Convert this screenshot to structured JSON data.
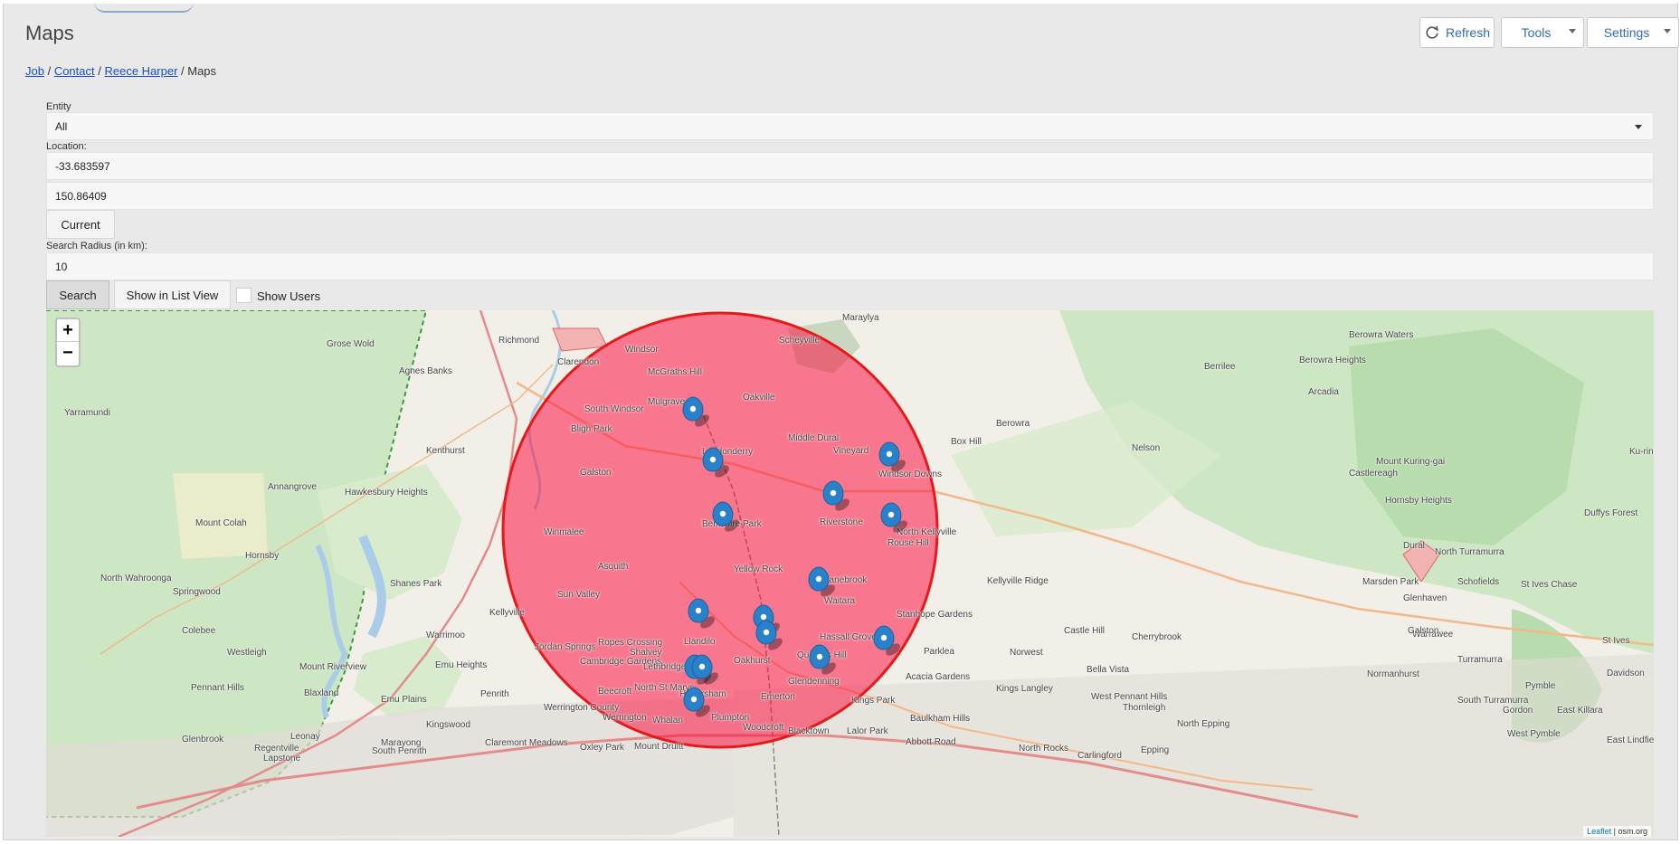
{
  "header": {
    "title": "Maps",
    "refresh_label": "Refresh",
    "tools_label": "Tools",
    "settings_label": "Settings"
  },
  "breadcrumb": {
    "items": [
      "Job",
      "Contact",
      "Reece Harper"
    ],
    "current": "Maps",
    "separator": " / "
  },
  "form": {
    "entity_label": "Entity",
    "entity_value": "All",
    "location_label": "Location:",
    "latitude": "-33.683597",
    "longitude": "150.86409",
    "current_button": "Current",
    "radius_label": "Search Radius (in km):",
    "radius_value": "10",
    "search_button": "Search",
    "list_view_button": "Show in List View",
    "show_users_label": "Show Users"
  },
  "map": {
    "zoom_in": "+",
    "zoom_out": "−",
    "attribution_leaflet": "Leaflet",
    "attribution_osm": "osm.org",
    "radius_color": "#f03",
    "places": [
      "Maraylya",
      "Grose Wold",
      "Richmond",
      "Clarendon",
      "Windsor",
      "Scheyville",
      "Berowra Waters",
      "Agnes Banks",
      "McGraths Hill",
      "Oakville",
      "Berrilee",
      "Berowra Heights",
      "Yarramundi",
      "South Windsor",
      "Mulgrave",
      "Arcadia",
      "Berowra",
      "Bligh Park",
      "Middle Dural",
      "Box Hill",
      "Kenthurst",
      "Londonderry",
      "Vineyard",
      "Nelson",
      "Galston",
      "Windsor Downs",
      "Annangrove",
      "Hawkesbury Heights",
      "Castlereagh",
      "Hornsby Heights",
      "Mount Colah",
      "Winmalee",
      "Berkshire Park",
      "Riverstone",
      "Rouse Hill",
      "North Kellyville",
      "Dural",
      "Asquith",
      "Yellow Rock",
      "Marsden Park",
      "Schofields",
      "Hornsby",
      "North Wahroonga",
      "Springwood",
      "Sun Valley",
      "Shanes Park",
      "Cranebrook",
      "Kellyville Ridge",
      "Glenhaven",
      "Waitara",
      "Stanhope Gardens",
      "Kellyville",
      "Llandilo",
      "Colebee",
      "Warrimoo",
      "Jordan Springs",
      "Ropes Crossing",
      "Shalvey",
      "Hassall Grove",
      "Parklea",
      "Norwest",
      "Castle Hill",
      "Cherrybrook",
      "Westleigh",
      "Mount Riverview",
      "Emu Heights",
      "Cambridge Gardens",
      "Lethbridge Park",
      "Oakhurst",
      "Quakers Hill",
      "Acacia Gardens",
      "Bella Vista",
      "Pennant Hills",
      "Blaxland",
      "Emu Plains",
      "Penrith",
      "Werrington County",
      "North St Marys",
      "Hebersham",
      "Glendenning",
      "Kings Park",
      "Kings Langley",
      "West Pennant Hills",
      "Beecroft",
      "Emerton",
      "Marayong",
      "Werrington",
      "Whalan",
      "Plumpton",
      "Woodcroft",
      "Blacktown",
      "Lalor Park",
      "Baulkham Hills",
      "North Epping",
      "Kingswood",
      "Claremont Meadows",
      "Oxley Park",
      "Mount Druitt",
      "Glenbrook",
      "Regentville",
      "South Penrith",
      "Leonay",
      "Lapstone",
      "North Rocks",
      "Carlingford",
      "Epping",
      "Davidson",
      "Gordon",
      "East Killara",
      "St Ives",
      "Pymble",
      "West Pymble",
      "Turramurra",
      "South Turramurra",
      "Warrawee",
      "Normanhurst",
      "Galston",
      "Ku-ring-gai",
      "Duffys Forest",
      "North Turramurra",
      "St Ives Chase",
      "Mount Kuring-gai",
      "Abbott Road",
      "East Lindfield",
      "Thornleigh"
    ]
  }
}
